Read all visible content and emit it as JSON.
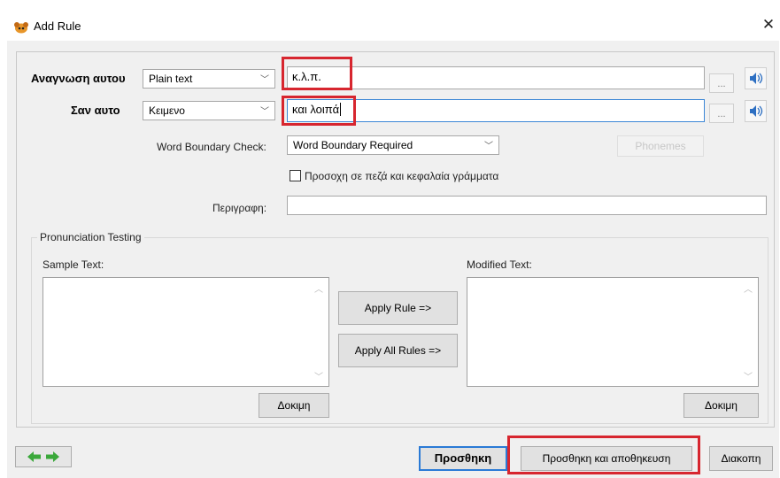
{
  "window": {
    "title": "Add Rule",
    "close_icon": "✕"
  },
  "rule": {
    "match_label": "Αναγνωση αυτου",
    "match_type": "Plain text",
    "match_value": "κ.λ.π.",
    "replace_label": "Σαν αυτο",
    "replace_type": "Κειμενο",
    "replace_value": "και λοιπά",
    "browse_label": "...",
    "word_boundary_label": "Word Boundary Check:",
    "word_boundary_value": "Word Boundary Required",
    "phonemes_label": "Phonemes",
    "case_sensitive_label": "Προσοχη σε πεζά και κεφαλαία γράμματα",
    "case_sensitive_checked": false,
    "description_label": "Περιγραφη:",
    "description_value": ""
  },
  "testing": {
    "group_label": "Pronunciation Testing",
    "sample_label": "Sample Text:",
    "modified_label": "Modified Text:",
    "apply_rule_label": "Apply Rule =>",
    "apply_all_label": "Apply All Rules =>",
    "test_label": "Δοκιμη"
  },
  "footer": {
    "add_label": "Προσθηκη",
    "add_save_label": "Προσθηκη και αποθηκευση",
    "cancel_label": "Διακοπη"
  },
  "colors": {
    "highlight": "#d7262f",
    "focus_border": "#3c87d6",
    "nav_arrows": "#3aa83a"
  },
  "icons": {
    "app": "app-icon",
    "speaker": "speaker-icon",
    "dropdown": "chevron-down-icon",
    "nav_back": "arrow-left-icon",
    "nav_forward": "arrow-right-icon"
  }
}
